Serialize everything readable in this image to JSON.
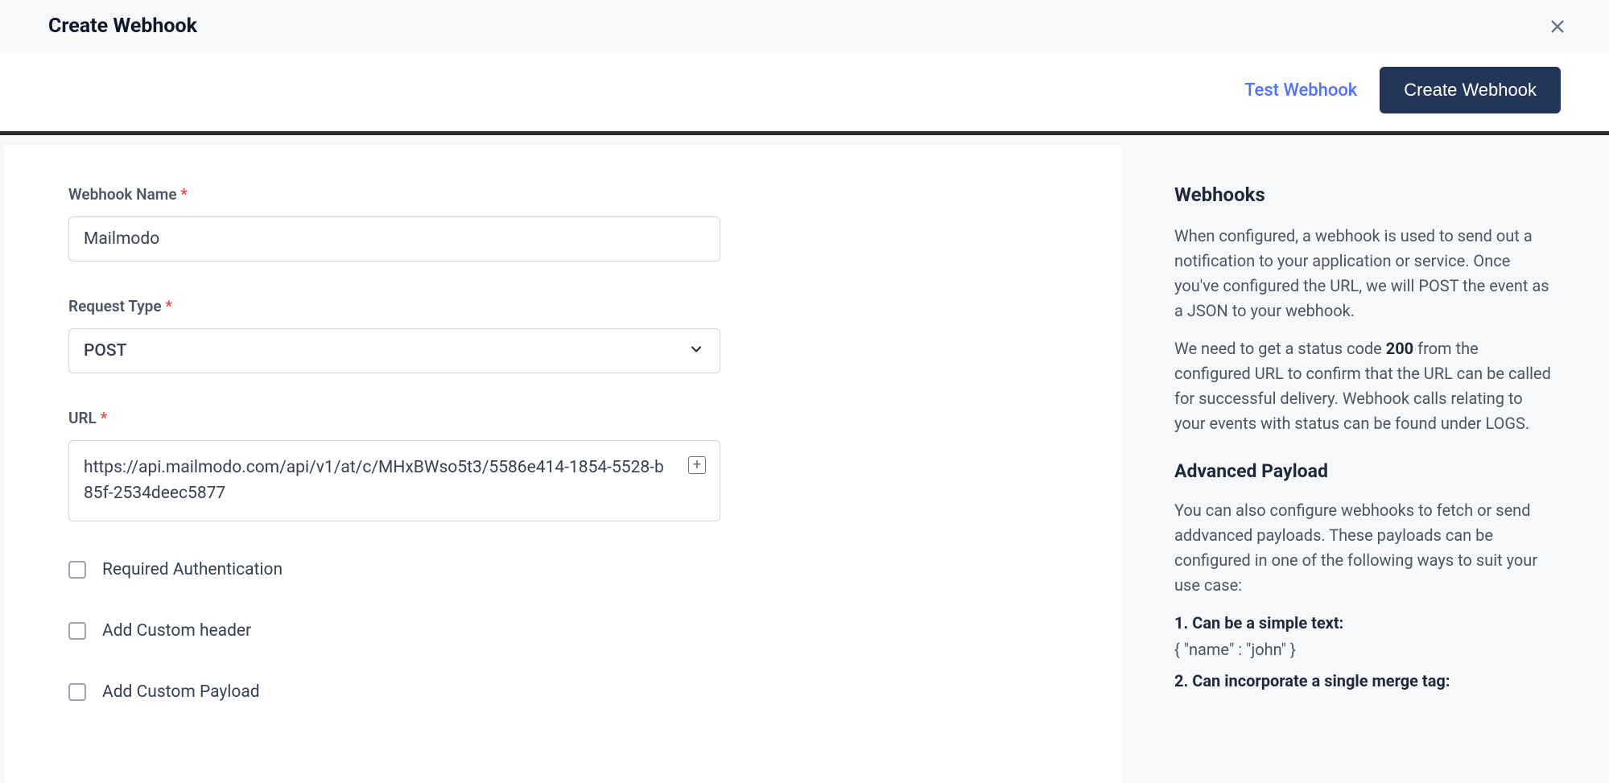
{
  "header": {
    "title": "Create Webhook"
  },
  "actions": {
    "test_label": "Test Webhook",
    "create_label": "Create Webhook"
  },
  "form": {
    "web:name_label": "Webhook Name",
    "name_value": "Mailmodo",
    "request_type_label": "Request Type",
    "request_type_value": "POST",
    "url_label": "URL",
    "url_value": "https://api.mailmodo.com/api/v1/at/c/MHxBWso5t3/5586e414-1854-5528-b85f-2534deec5877",
    "checkboxes": {
      "auth": "Required Authentication",
      "header": "Add Custom header",
      "payload": "Add Custom Payload"
    }
  },
  "side": {
    "title": "Webhooks",
    "para1": "When configured, a webhook is used to send out a notification to your application or service. Once you've configured the URL, we will POST the event as a JSON to your webhook.",
    "para2a": "We need to get a status code ",
    "para2b": "200",
    "para2c": " from the configured URL to confirm that the URL can be called for successful delivery. Webhook calls relating to your events with status can be found under LOGS.",
    "subtitle": "Advanced Payload",
    "para3": "You can also configure webhooks to fetch or send addvanced payloads. These payloads can be configured in one of the following ways to suit your use case:",
    "item1_header": "1. Can be a simple text:",
    "item1_body": "{ \"name\" : \"john\" }",
    "item2_header": "2. Can incorporate a single merge tag:"
  }
}
